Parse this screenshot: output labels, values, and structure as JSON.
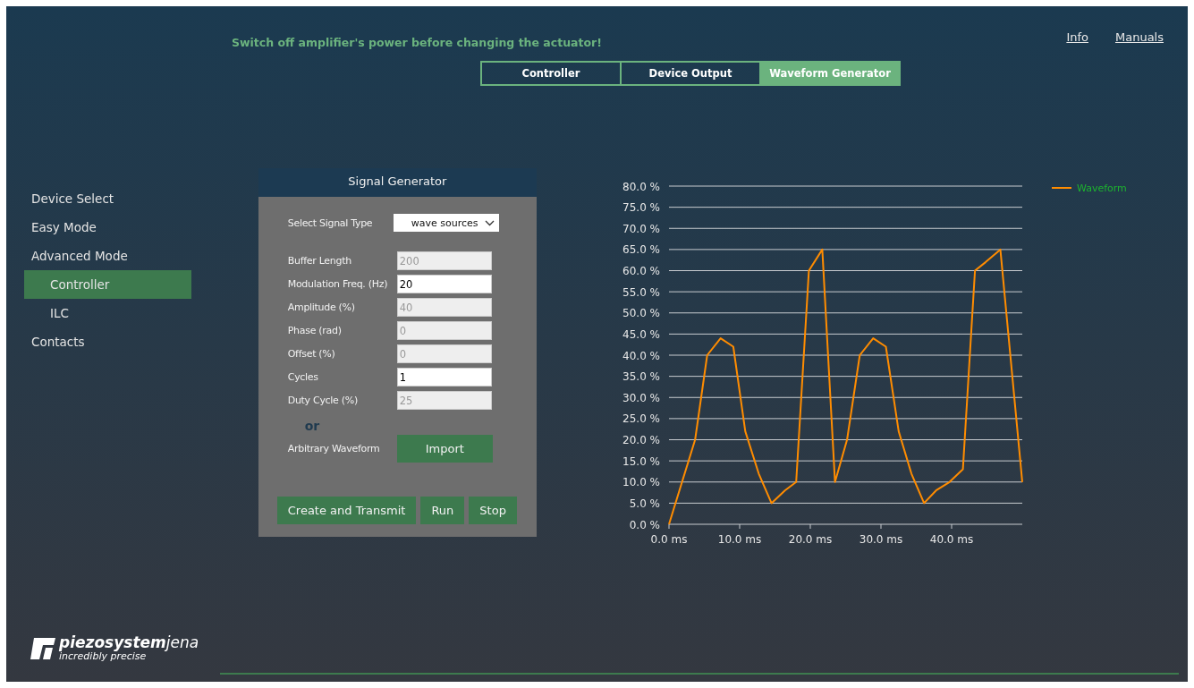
{
  "header": {
    "warning": "Switch off amplifier's power before changing the actuator!",
    "links": [
      "Info",
      "Manuals"
    ]
  },
  "tabs": [
    {
      "label": "Controller",
      "selected": false
    },
    {
      "label": "Device Output",
      "selected": false
    },
    {
      "label": "Waveform Generator",
      "selected": true
    }
  ],
  "sidebar": {
    "items": [
      {
        "label": "Device Select",
        "selected": false
      },
      {
        "label": "Easy Mode",
        "selected": false
      },
      {
        "label": "Advanced Mode",
        "selected": false,
        "children": [
          {
            "label": "Controller",
            "selected": true
          },
          {
            "label": "ILC",
            "selected": false
          }
        ]
      },
      {
        "label": "Contacts",
        "selected": false
      }
    ]
  },
  "signal_generator": {
    "title": "Signal Generator",
    "signal_type_label": "Select Signal Type",
    "signal_type": "wave sources",
    "fields": [
      {
        "label": "Buffer Length",
        "value": "200",
        "disabled": true
      },
      {
        "label": "Modulation Freq. (Hz)",
        "value": "20",
        "disabled": false
      },
      {
        "label": "Amplitude (%)",
        "value": "40",
        "disabled": true
      },
      {
        "label": "Phase (rad)",
        "value": "0",
        "disabled": true
      },
      {
        "label": "Offset (%)",
        "value": "0",
        "disabled": true
      },
      {
        "label": "Cycles",
        "value": "1",
        "disabled": false
      },
      {
        "label": "Duty Cycle (%)",
        "value": "25",
        "disabled": true
      }
    ],
    "or_text": "or",
    "arbitrary_label": "Arbitrary Waveform",
    "import_button": "Import",
    "buttons": [
      "Create and Transmit",
      "Run",
      "Stop"
    ]
  },
  "chart_data": {
    "type": "line",
    "x": [
      0,
      3.7,
      5.4,
      7.3,
      9.1,
      10.8,
      12.7,
      14.5,
      16.4,
      18.0,
      19.8,
      21.7,
      23.5,
      25.2,
      27.0,
      28.9,
      30.7,
      32.5,
      34.3,
      36.1,
      37.8,
      39.7,
      41.6,
      43.3,
      44.8,
      46.9,
      50
    ],
    "series": [
      {
        "name": "Waveform",
        "color": "#ff8c00",
        "values": [
          0,
          20,
          40,
          44,
          42,
          22,
          12,
          5,
          8,
          10,
          60,
          65,
          10,
          20,
          40,
          44,
          42,
          22,
          12,
          5,
          8,
          10,
          13,
          60,
          62,
          65,
          10
        ]
      }
    ],
    "xlim": [
      0,
      50
    ],
    "ylim": [
      0,
      80
    ],
    "grid": true,
    "xticks": [
      {
        "value": 0,
        "label": "0.0 ms"
      },
      {
        "value": 10,
        "label": "10.0 ms"
      },
      {
        "value": 20,
        "label": "20.0 ms"
      },
      {
        "value": 30,
        "label": "30.0 ms"
      },
      {
        "value": 40,
        "label": "40.0 ms"
      }
    ],
    "yticks": [
      {
        "value": 0,
        "label": "0.0 %"
      },
      {
        "value": 5,
        "label": "5.0 %"
      },
      {
        "value": 10,
        "label": "10.0 %"
      },
      {
        "value": 15,
        "label": "15.0 %"
      },
      {
        "value": 20,
        "label": "20.0 %"
      },
      {
        "value": 25,
        "label": "25.0 %"
      },
      {
        "value": 30,
        "label": "30.0 %"
      },
      {
        "value": 35,
        "label": "35.0 %"
      },
      {
        "value": 40,
        "label": "40.0 %"
      },
      {
        "value": 45,
        "label": "45.0 %"
      },
      {
        "value": 50,
        "label": "50.0 %"
      },
      {
        "value": 55,
        "label": "55.0 %"
      },
      {
        "value": 60,
        "label": "60.0 %"
      },
      {
        "value": 65,
        "label": "65.0 %"
      },
      {
        "value": 70,
        "label": "70.0 %"
      },
      {
        "value": 75,
        "label": "75.0 %"
      },
      {
        "value": 80,
        "label": "80.0 %"
      }
    ]
  },
  "logo": {
    "name": "piezosystem",
    "suffix": "jena",
    "tagline": "incredibly precise"
  }
}
